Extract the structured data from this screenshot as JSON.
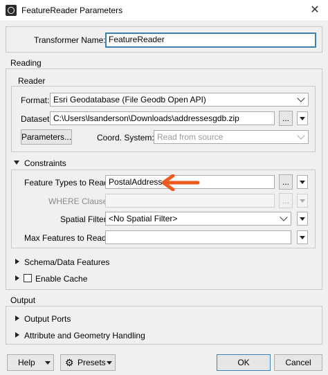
{
  "window": {
    "title": "FeatureReader Parameters",
    "close_glyph": "✕"
  },
  "transformer": {
    "label": "Transformer Name:",
    "value": "FeatureReader"
  },
  "reading": {
    "title": "Reading",
    "reader": {
      "title": "Reader",
      "format_label": "Format:",
      "format_value": "Esri Geodatabase (File Geodb Open API)",
      "dataset_label": "Dataset:",
      "dataset_value": "C:\\Users\\lsanderson\\Downloads\\addressesgdb.zip",
      "browse_label": "...",
      "parameters_label": "Parameters...",
      "coord_label": "Coord. System:",
      "coord_placeholder": "Read from source"
    },
    "constraints": {
      "title": "Constraints",
      "feature_types_label": "Feature Types to Read:",
      "feature_types_value": "PostalAddress",
      "where_label": "WHERE Clause:",
      "where_value": "",
      "spatial_label": "Spatial Filter:",
      "spatial_value": "<No Spatial Filter>",
      "max_label": "Max Features to Read:",
      "max_value": ""
    },
    "schema_title": "Schema/Data Features",
    "cache_label": "Enable Cache"
  },
  "output": {
    "title": "Output",
    "ports_label": "Output Ports",
    "attr_label": "Attribute and Geometry Handling"
  },
  "footer": {
    "help": "Help",
    "presets": "Presets",
    "ok": "OK",
    "cancel": "Cancel"
  },
  "colors": {
    "annotation_arrow": "#ec5a1e",
    "focus_border": "#3c7fb1"
  }
}
